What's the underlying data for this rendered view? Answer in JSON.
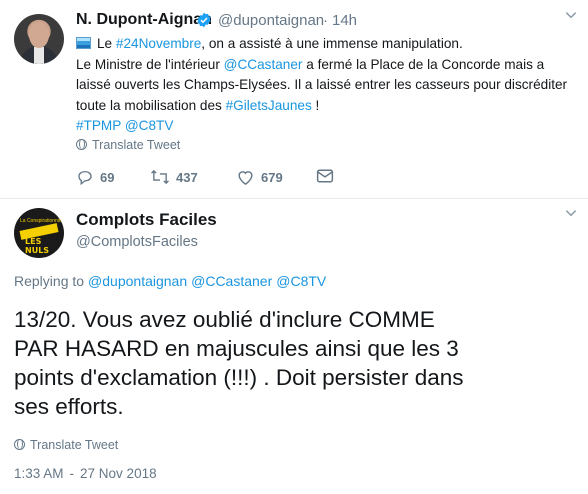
{
  "quoted_tweet": {
    "author_name": "N. Dupont-Aignan",
    "handle": "@dupontaignan",
    "dot": "·",
    "time": "14h",
    "lines": [
      [
        {
          "t": "Le ",
          "c": "text"
        },
        {
          "t": "#24Novembre",
          "c": "link"
        },
        {
          "t": ", on a assisté à une immense manipulation.",
          "c": "text"
        }
      ],
      [
        {
          "t": "Le Ministre de l'intérieur ",
          "c": "text"
        },
        {
          "t": "@CCastaner",
          "c": "link"
        },
        {
          "t": " a fermé la Place de la Concorde mais a",
          "c": "text"
        }
      ],
      [
        {
          "t": "laissé ouverts les Champs-Elysées. Il a laissé entrer les casseurs pour discréditer",
          "c": "text"
        }
      ],
      [
        {
          "t": "toute la mobilisation des ",
          "c": "text"
        },
        {
          "t": "#GiletsJaunes",
          "c": "link"
        },
        {
          "t": " !",
          "c": "text"
        }
      ],
      [
        {
          "t": "#TPMP",
          "c": "link"
        },
        {
          "t": " ",
          "c": "text"
        },
        {
          "t": "@C8TV",
          "c": "link"
        }
      ]
    ],
    "translate_label": "Translate Tweet",
    "actions": {
      "replies": "69",
      "retweets": "437",
      "likes": "679"
    }
  },
  "main_tweet": {
    "author_name": "Complots Faciles",
    "handle": "@ComplotsFaciles",
    "replying_prefix": "Replying to",
    "replying_to": [
      "@dupontaignan",
      "@CCastaner",
      "@C8TV"
    ],
    "lines": [
      "13/20. Vous avez oublié d'inclure COMME",
      "PAR HASARD en majuscules ainsi que les 3",
      "points d'exclamation (!!!) . Doit persister dans",
      "ses efforts."
    ],
    "translate_label": "Translate Tweet",
    "time": "1:33 AM",
    "separator": "-",
    "date": "27 Nov 2018"
  },
  "avatar_text": {
    "small": "La Conspirationnite",
    "big": "LES NULS"
  },
  "colors": {
    "link": "#1b95e0",
    "muted": "#657786",
    "text": "#14171a",
    "verified": "#1da1f2"
  },
  "icons": [
    "verified-badge-icon",
    "chevron-down-icon",
    "flag-emoji-icon",
    "globe-icon",
    "reply-icon",
    "retweet-icon",
    "heart-icon",
    "envelope-icon"
  ]
}
